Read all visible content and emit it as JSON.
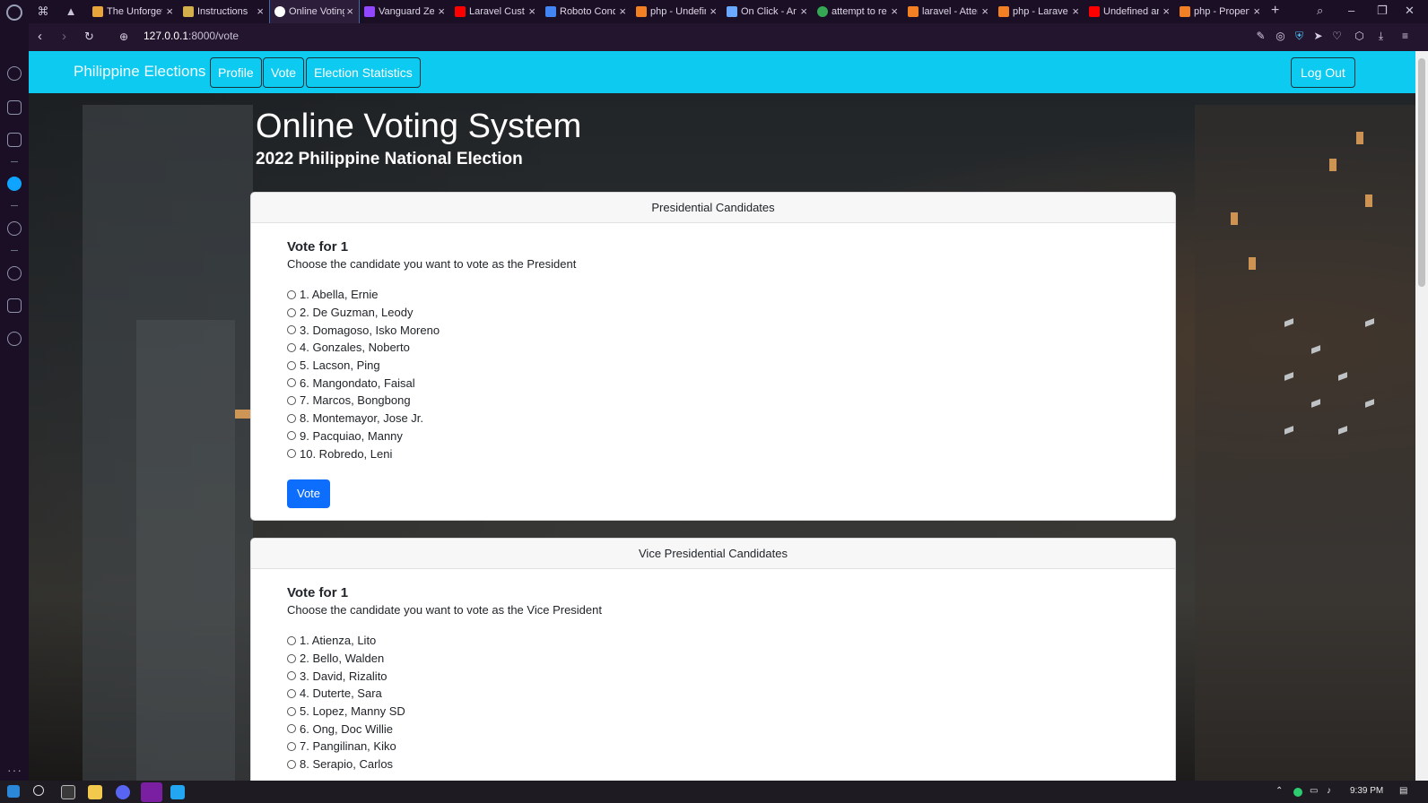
{
  "browser": {
    "tabs": [
      {
        "title": "The Unforgettable",
        "favicon_color": "#e8a53a"
      },
      {
        "title": "Instructions",
        "favicon_color": "#d4b04a"
      },
      {
        "title": "Online Voting System",
        "favicon_color": "#ffffff",
        "active": true
      },
      {
        "title": "Vanguard Zero",
        "favicon_color": "#9146ff"
      },
      {
        "title": "Laravel Custom",
        "favicon_color": "#ff0000"
      },
      {
        "title": "Roboto Condensed",
        "favicon_color": "#4285f4"
      },
      {
        "title": "php - Undefined",
        "favicon_color": "#f48024"
      },
      {
        "title": "On Click - Angular",
        "favicon_color": "#6aa9ff"
      },
      {
        "title": "attempt to read",
        "favicon_color": "#34a853"
      },
      {
        "title": "laravel - Attempt",
        "favicon_color": "#f48024"
      },
      {
        "title": "php - Laravel",
        "favicon_color": "#f48024"
      },
      {
        "title": "Undefined array",
        "favicon_color": "#ff0000"
      },
      {
        "title": "php - Property",
        "favicon_color": "#f48024"
      }
    ],
    "address": {
      "host": "127.0.0.1",
      "path": ":8000/vote"
    }
  },
  "navbar": {
    "brand": "Philippine Elections",
    "links": [
      "Profile",
      "Vote",
      "Election Statistics"
    ],
    "logout": "Log Out"
  },
  "hero": {
    "title": "Online Voting System",
    "subtitle": "2022 Philippine National Election"
  },
  "sections": [
    {
      "header": "Presidential Candidates",
      "vote_for": "Vote for 1",
      "description": "Choose the candidate you want to vote as the President",
      "candidates": [
        "1. Abella, Ernie",
        "2. De Guzman, Leody",
        "3. Domagoso, Isko Moreno",
        "4. Gonzales, Noberto",
        "5. Lacson, Ping",
        "6. Mangondato, Faisal",
        "7. Marcos, Bongbong",
        "8. Montemayor, Jose Jr.",
        "9. Pacquiao, Manny",
        "10. Robredo, Leni"
      ],
      "button": "Vote"
    },
    {
      "header": "Vice Presidential Candidates",
      "vote_for": "Vote for 1",
      "description": "Choose the candidate you want to vote as the Vice President",
      "candidates": [
        "1. Atienza, Lito",
        "2. Bello, Walden",
        "3. David, Rizalito",
        "4. Duterte, Sara",
        "5. Lopez, Manny SD",
        "6. Ong, Doc Willie",
        "7. Pangilinan, Kiko",
        "8. Serapio, Carlos"
      ]
    }
  ],
  "taskbar": {
    "time": "9:39 PM"
  }
}
